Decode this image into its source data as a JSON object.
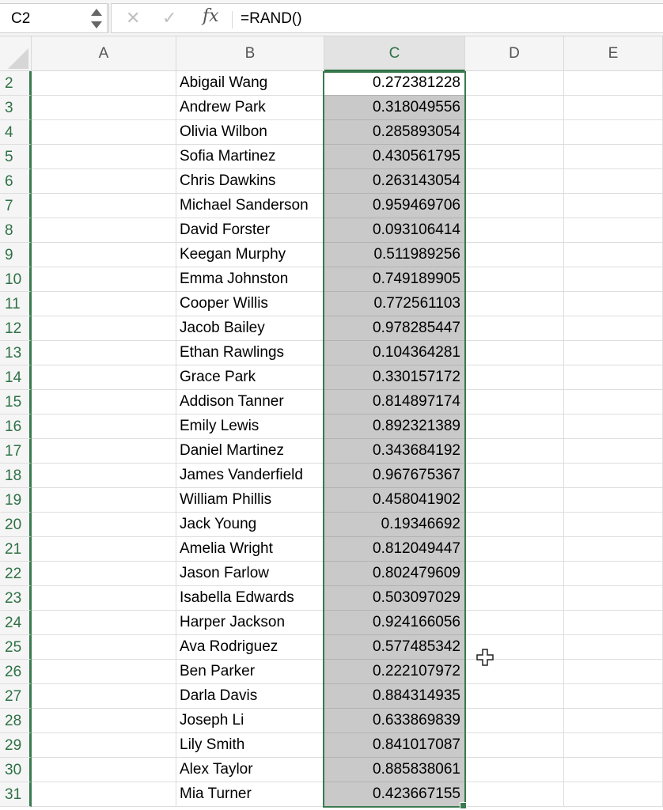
{
  "formula_bar": {
    "name_box": "C2",
    "cancel_icon": "✕",
    "enter_icon": "✓",
    "fx_label": "fx",
    "formula": "=RAND()"
  },
  "columns": [
    "A",
    "B",
    "C",
    "D",
    "E"
  ],
  "active_column": "C",
  "active_cell": "C2",
  "rows": [
    {
      "num": "2",
      "name": "Abigail Wang",
      "value": "0.272381228"
    },
    {
      "num": "3",
      "name": "Andrew Park",
      "value": "0.318049556"
    },
    {
      "num": "4",
      "name": "Olivia Wilbon",
      "value": "0.285893054"
    },
    {
      "num": "5",
      "name": "Sofia Martinez",
      "value": "0.430561795"
    },
    {
      "num": "6",
      "name": "Chris Dawkins",
      "value": "0.263143054"
    },
    {
      "num": "7",
      "name": "Michael Sanderson",
      "value": "0.959469706"
    },
    {
      "num": "8",
      "name": "David Forster",
      "value": "0.093106414"
    },
    {
      "num": "9",
      "name": "Keegan Murphy",
      "value": "0.511989256"
    },
    {
      "num": "10",
      "name": "Emma Johnston",
      "value": "0.749189905"
    },
    {
      "num": "11",
      "name": "Cooper Willis",
      "value": "0.772561103"
    },
    {
      "num": "12",
      "name": "Jacob Bailey",
      "value": "0.978285447"
    },
    {
      "num": "13",
      "name": "Ethan Rawlings",
      "value": "0.104364281"
    },
    {
      "num": "14",
      "name": "Grace Park",
      "value": "0.330157172"
    },
    {
      "num": "15",
      "name": "Addison Tanner",
      "value": "0.814897174"
    },
    {
      "num": "16",
      "name": "Emily Lewis",
      "value": "0.892321389"
    },
    {
      "num": "17",
      "name": "Daniel Martinez",
      "value": "0.343684192"
    },
    {
      "num": "18",
      "name": "James Vanderfield",
      "value": "0.967675367"
    },
    {
      "num": "19",
      "name": "William Phillis",
      "value": "0.458041902"
    },
    {
      "num": "20",
      "name": "Jack Young",
      "value": "0.19346692"
    },
    {
      "num": "21",
      "name": "Amelia Wright",
      "value": "0.812049447"
    },
    {
      "num": "22",
      "name": "Jason Farlow",
      "value": "0.802479609"
    },
    {
      "num": "23",
      "name": "Isabella Edwards",
      "value": "0.503097029"
    },
    {
      "num": "24",
      "name": "Harper Jackson",
      "value": "0.924166056"
    },
    {
      "num": "25",
      "name": "Ava Rodriguez",
      "value": "0.577485342"
    },
    {
      "num": "26",
      "name": "Ben Parker",
      "value": "0.222107972"
    },
    {
      "num": "27",
      "name": "Darla Davis",
      "value": "0.884314935"
    },
    {
      "num": "28",
      "name": "Joseph Li",
      "value": "0.633869839"
    },
    {
      "num": "29",
      "name": "Lily Smith",
      "value": "0.841017087"
    },
    {
      "num": "30",
      "name": "Alex Taylor",
      "value": "0.885838061"
    },
    {
      "num": "31",
      "name": "Mia Turner",
      "value": "0.423667155"
    }
  ],
  "colors": {
    "selection": "#3a7a4f",
    "selected_fill": "#c9c9c9",
    "header_text_active": "#2e7145"
  }
}
